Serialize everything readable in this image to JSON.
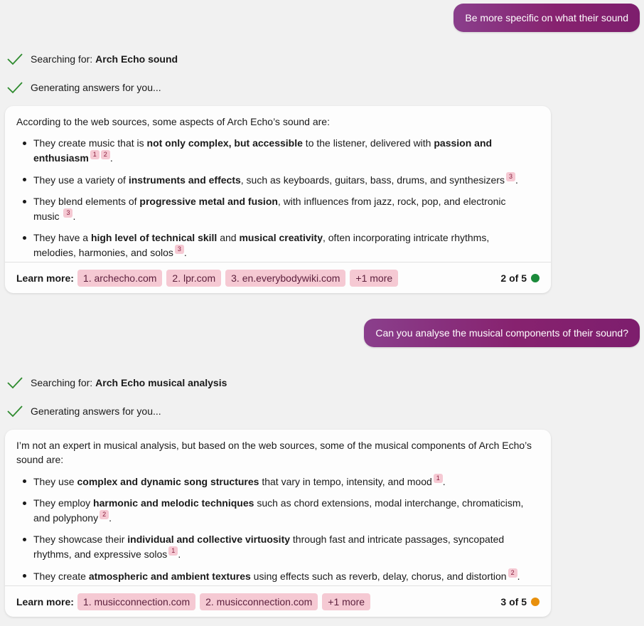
{
  "turns": [
    {
      "user_message": "Be more specific on what their sound",
      "status": [
        {
          "prefix": "Searching for:",
          "query": "Arch Echo sound"
        },
        {
          "prefix": "Generating answers for you...",
          "query": ""
        }
      ],
      "answer": {
        "intro": "According to the web sources, some aspects of Arch Echo’s sound are:",
        "bullets": [
          {
            "parts": [
              {
                "t": "They create music that is "
              },
              {
                "b": "not only complex, but accessible"
              },
              {
                "t": " to the listener, delivered with "
              },
              {
                "b": "passion and enthusiasm"
              },
              {
                "c": "1"
              },
              {
                "c": "2"
              },
              {
                "t": "."
              }
            ]
          },
          {
            "parts": [
              {
                "t": "They use a variety of "
              },
              {
                "b": "instruments and effects"
              },
              {
                "t": ", such as keyboards, guitars, bass, drums, and synthesizers"
              },
              {
                "c": "3"
              },
              {
                "t": "."
              }
            ]
          },
          {
            "parts": [
              {
                "t": "They blend elements of "
              },
              {
                "b": "progressive metal and fusion"
              },
              {
                "t": ", with influences from jazz, rock, pop, and electronic music "
              },
              {
                "c": "3"
              },
              {
                "t": "."
              }
            ]
          },
          {
            "parts": [
              {
                "t": "They have a "
              },
              {
                "b": "high level of technical skill"
              },
              {
                "t": " and "
              },
              {
                "b": "musical creativity"
              },
              {
                "t": ", often incorporating intricate rhythms, melodies, harmonies, and solos"
              },
              {
                "c": "3"
              },
              {
                "t": "."
              }
            ]
          }
        ],
        "learn_more_label": "Learn more:",
        "sources": [
          "1. archecho.com",
          "2. lpr.com",
          "3. en.everybodywiki.com",
          "+1 more"
        ],
        "counter": "2 of 5",
        "dot_color": "#1b8a3a"
      }
    },
    {
      "user_message": "Can you analyse the musical components of their sound?",
      "status": [
        {
          "prefix": "Searching for:",
          "query": "Arch Echo musical analysis"
        },
        {
          "prefix": "Generating answers for you...",
          "query": ""
        }
      ],
      "answer": {
        "intro": "I’m not an expert in musical analysis, but based on the web sources, some of the musical components of Arch Echo’s sound are:",
        "bullets": [
          {
            "parts": [
              {
                "t": "They use "
              },
              {
                "b": "complex and dynamic song structures"
              },
              {
                "t": " that vary in tempo, intensity, and mood"
              },
              {
                "c": "1"
              },
              {
                "t": "."
              }
            ]
          },
          {
            "parts": [
              {
                "t": "They employ "
              },
              {
                "b": "harmonic and melodic techniques"
              },
              {
                "t": " such as chord extensions, modal interchange, chromaticism, and polyphony"
              },
              {
                "c": "2"
              },
              {
                "t": "."
              }
            ]
          },
          {
            "parts": [
              {
                "t": "They showcase their "
              },
              {
                "b": "individual and collective virtuosity"
              },
              {
                "t": " through fast and intricate passages, syncopated rhythms, and expressive solos"
              },
              {
                "c": "1"
              },
              {
                "t": "."
              }
            ]
          },
          {
            "parts": [
              {
                "t": "They create "
              },
              {
                "b": "atmospheric and ambient textures"
              },
              {
                "t": " using effects such as reverb, delay, chorus, and distortion"
              },
              {
                "c": "2"
              },
              {
                "t": "."
              }
            ]
          }
        ],
        "learn_more_label": "Learn more:",
        "sources": [
          "1. musicconnection.com",
          "2. musicconnection.com",
          "+1 more"
        ],
        "counter": "3 of 5",
        "dot_color": "#e8900c"
      }
    }
  ],
  "colors": {
    "check": "#2e8b2e",
    "chip_bg": "#f5c9d3",
    "user_bubble": "#87226f"
  },
  "icons": {
    "status": "checkmark-icon"
  }
}
